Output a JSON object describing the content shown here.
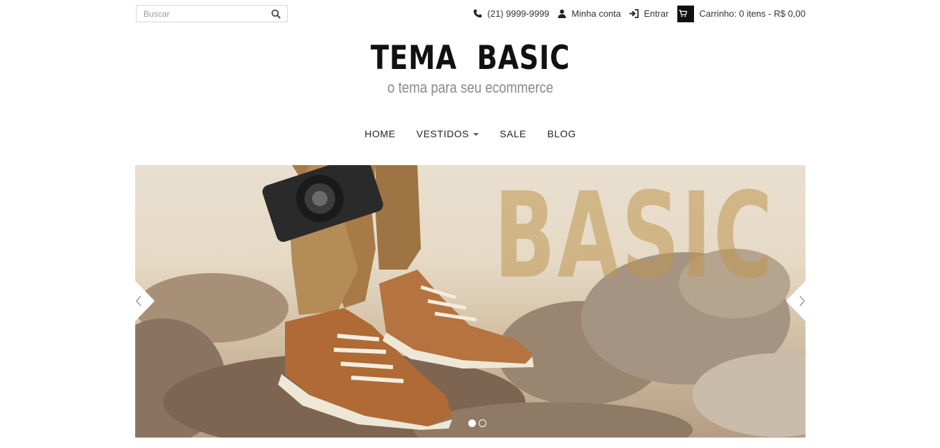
{
  "search": {
    "placeholder": "Buscar"
  },
  "topbar": {
    "phone": "(21) 9999-9999",
    "account": "Minha conta",
    "login": "Entrar",
    "cart": "Carrinho: 0 itens - R$ 0,00"
  },
  "logo": {
    "title": "TEMA  BASIC",
    "subtitle": "o tema para seu ecommerce"
  },
  "nav": {
    "items": [
      "HOME",
      "VESTIDOS",
      "SALE",
      "BLOG"
    ]
  },
  "banner": {
    "overlay_text": "BASIC",
    "slide_count": 2,
    "active_slide": 1
  },
  "icons": [
    "search-icon",
    "phone-icon",
    "user-icon",
    "sign-in-icon",
    "cart-icon",
    "chevron-left-icon",
    "chevron-right-icon",
    "caret-down-icon"
  ]
}
